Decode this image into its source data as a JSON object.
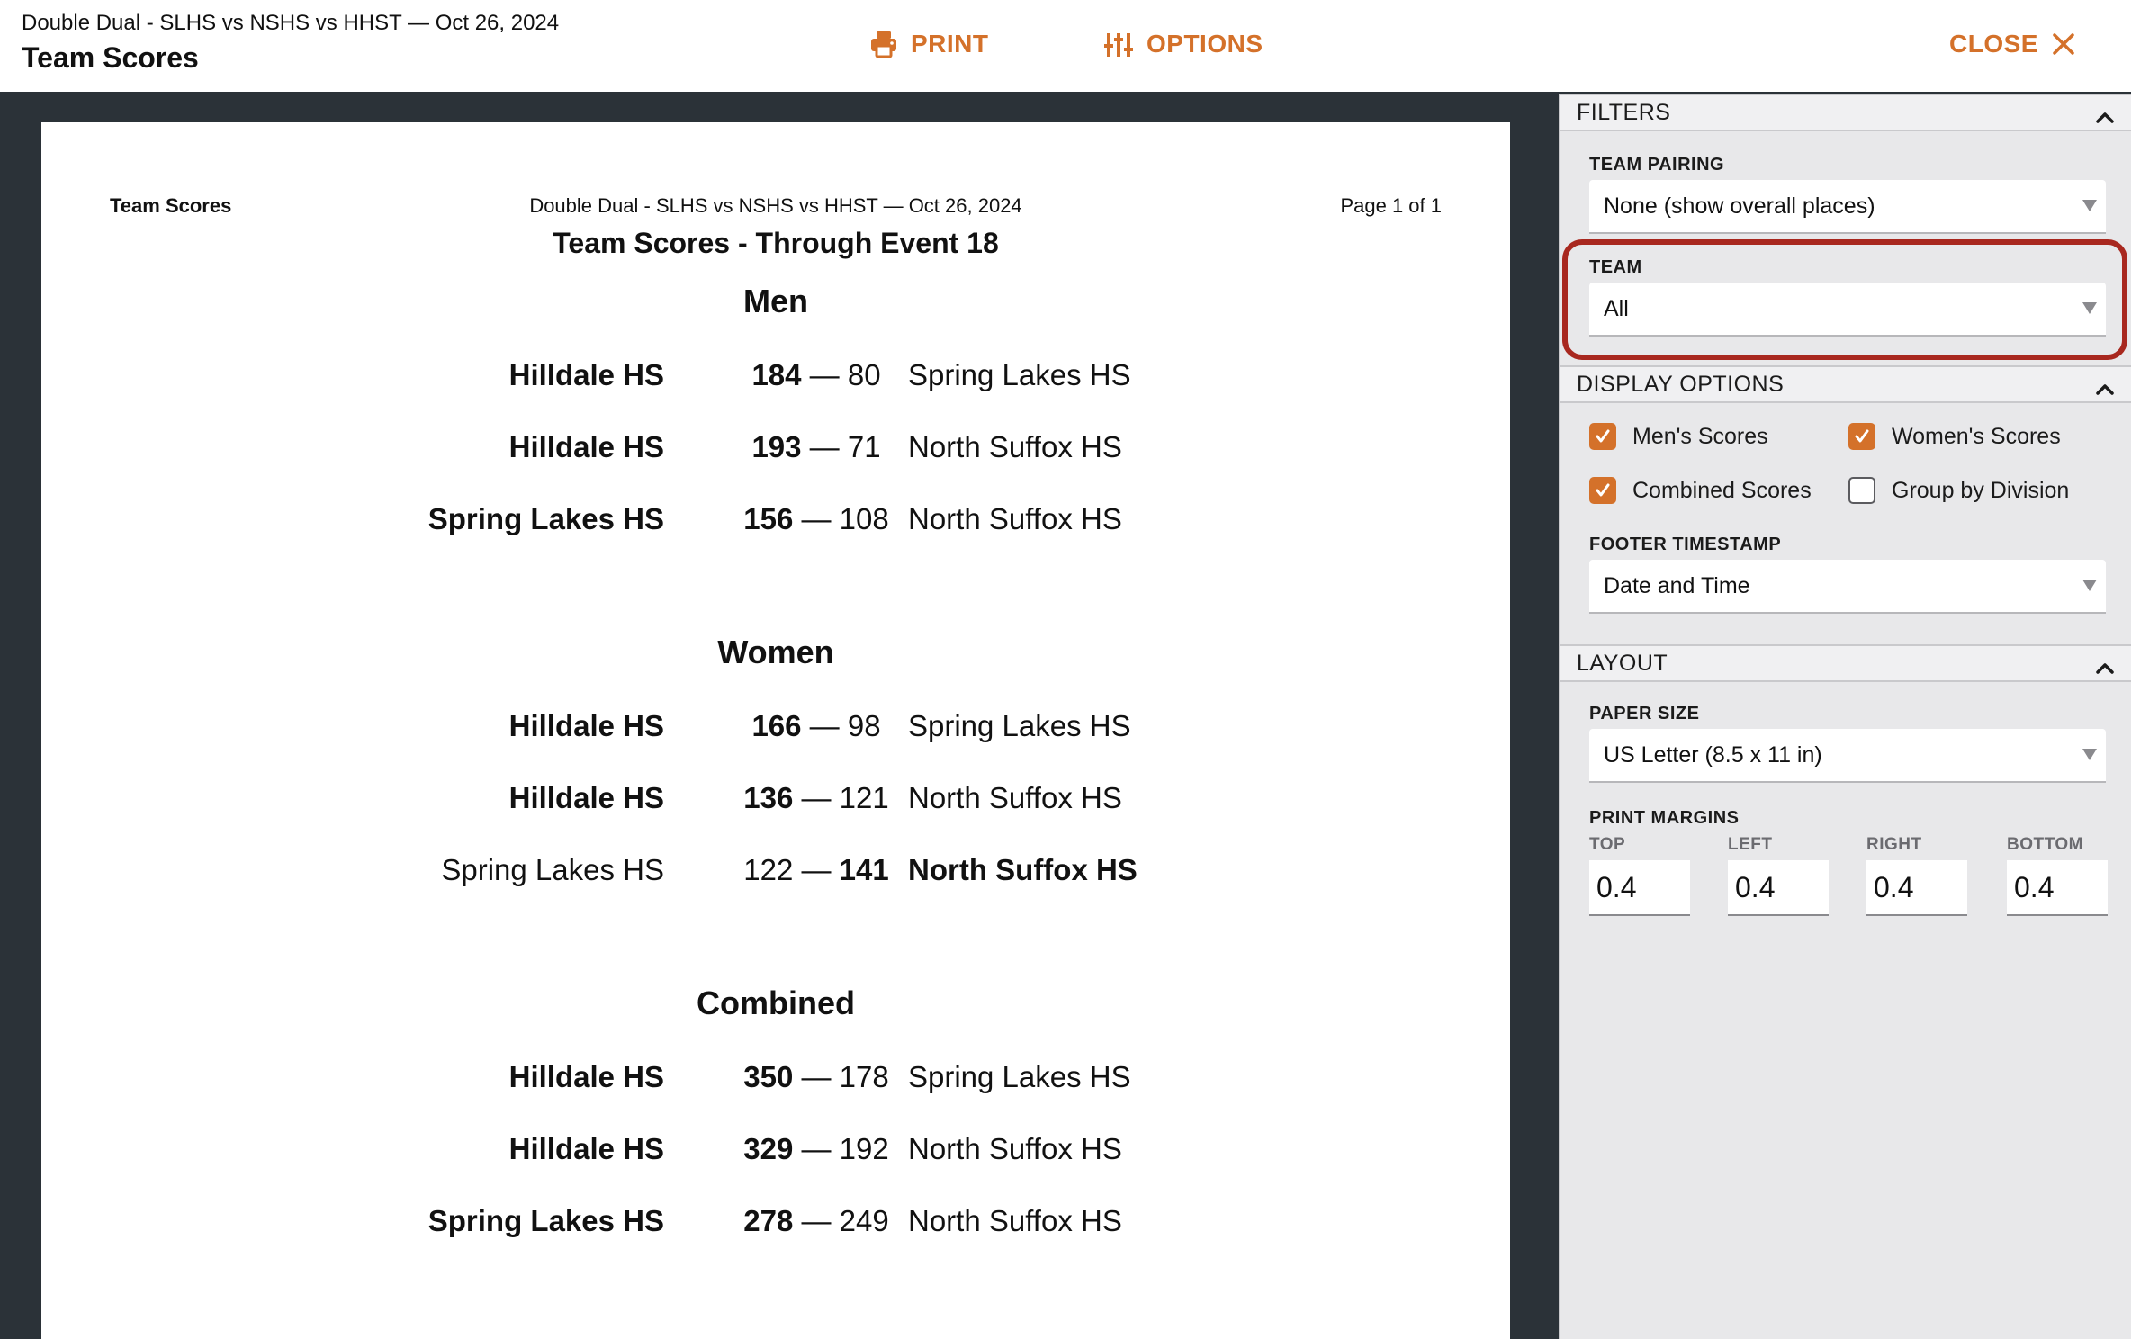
{
  "header": {
    "subtitle": "Double Dual - SLHS vs NSHS vs HHST — Oct 26, 2024",
    "title": "Team Scores",
    "print_label": "PRINT",
    "options_label": "OPTIONS",
    "close_label": "CLOSE"
  },
  "report": {
    "header_left": "Team Scores",
    "header_center": "Double Dual - SLHS vs NSHS vs HHST — Oct 26, 2024",
    "header_right": "Page 1 of 1",
    "title": "Team Scores - Through Event 18",
    "sections": [
      {
        "title": "Men",
        "rows": [
          {
            "team_a": "Hilldale HS",
            "score_a": "184",
            "score_b": "80",
            "team_b": "Spring Lakes HS",
            "winner": "a"
          },
          {
            "team_a": "Hilldale HS",
            "score_a": "193",
            "score_b": "71",
            "team_b": "North Suffox HS",
            "winner": "a"
          },
          {
            "team_a": "Spring Lakes HS",
            "score_a": "156",
            "score_b": "108",
            "team_b": "North Suffox HS",
            "winner": "a"
          }
        ]
      },
      {
        "title": "Women",
        "rows": [
          {
            "team_a": "Hilldale HS",
            "score_a": "166",
            "score_b": "98",
            "team_b": "Spring Lakes HS",
            "winner": "a"
          },
          {
            "team_a": "Hilldale HS",
            "score_a": "136",
            "score_b": "121",
            "team_b": "North Suffox HS",
            "winner": "a"
          },
          {
            "team_a": "Spring Lakes HS",
            "score_a": "122",
            "score_b": "141",
            "team_b": "North Suffox HS",
            "winner": "b"
          }
        ]
      },
      {
        "title": "Combined",
        "rows": [
          {
            "team_a": "Hilldale HS",
            "score_a": "350",
            "score_b": "178",
            "team_b": "Spring Lakes HS",
            "winner": "a"
          },
          {
            "team_a": "Hilldale HS",
            "score_a": "329",
            "score_b": "192",
            "team_b": "North Suffox HS",
            "winner": "a"
          },
          {
            "team_a": "Spring Lakes HS",
            "score_a": "278",
            "score_b": "249",
            "team_b": "North Suffox HS",
            "winner": "a"
          }
        ]
      }
    ]
  },
  "panel": {
    "filters": {
      "header": "FILTERS",
      "team_pairing_label": "TEAM PAIRING",
      "team_pairing_value": "None (show overall places)",
      "team_label": "TEAM",
      "team_value": "All"
    },
    "display_options": {
      "header": "DISPLAY OPTIONS",
      "mens_scores": "Men's Scores",
      "womens_scores": "Women's Scores",
      "combined_scores": "Combined Scores",
      "group_by_division": "Group by Division",
      "mens_checked": true,
      "womens_checked": true,
      "combined_checked": true,
      "group_checked": false,
      "footer_timestamp_label": "FOOTER TIMESTAMP",
      "footer_timestamp_value": "Date and Time"
    },
    "layout": {
      "header": "LAYOUT",
      "paper_size_label": "PAPER SIZE",
      "paper_size_value": "US Letter (8.5 x 11 in)",
      "print_margins_label": "PRINT MARGINS",
      "margins": [
        {
          "label": "TOP",
          "value": "0.4"
        },
        {
          "label": "LEFT",
          "value": "0.4"
        },
        {
          "label": "RIGHT",
          "value": "0.4"
        },
        {
          "label": "BOTTOM",
          "value": "0.4"
        }
      ]
    }
  },
  "colors": {
    "accent": "#d4712a",
    "highlight": "#a8281f",
    "preview_bg": "#2b3238"
  }
}
